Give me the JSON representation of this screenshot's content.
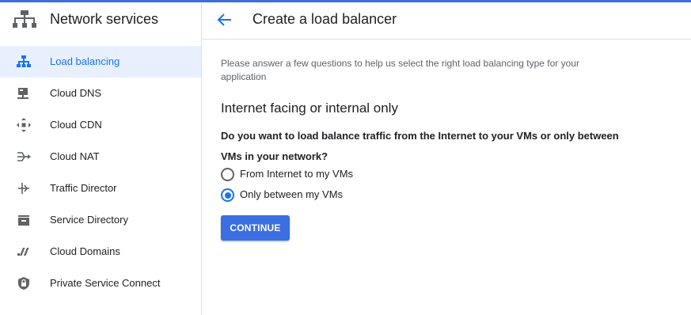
{
  "colors": {
    "accent": "#1a73e8",
    "button": "#3b6ee0",
    "active_bg": "#e8f0fe"
  },
  "sidebar": {
    "title": "Network services",
    "icon": "network-services-icon",
    "items": [
      {
        "label": "Load balancing",
        "icon": "load-balancing-icon",
        "active": true
      },
      {
        "label": "Cloud DNS",
        "icon": "cloud-dns-icon"
      },
      {
        "label": "Cloud CDN",
        "icon": "cloud-cdn-icon"
      },
      {
        "label": "Cloud NAT",
        "icon": "cloud-nat-icon"
      },
      {
        "label": "Traffic Director",
        "icon": "traffic-director-icon"
      },
      {
        "label": "Service Directory",
        "icon": "service-directory-icon"
      },
      {
        "label": "Cloud Domains",
        "icon": "cloud-domains-icon"
      },
      {
        "label": "Private Service Connect",
        "icon": "private-service-connect-icon"
      }
    ]
  },
  "main": {
    "back_icon": "arrow-back-icon",
    "title": "Create a load balancer",
    "intro": "Please answer a few questions to help us select the right load balancing type for your application",
    "section_title": "Internet facing or internal only",
    "question": "Do you want to load balance traffic from the Internet to your VMs or only between VMs in your network?",
    "options": [
      {
        "label": "From Internet to my VMs",
        "selected": false
      },
      {
        "label": "Only between my VMs",
        "selected": true
      }
    ],
    "continue_label": "CONTINUE"
  }
}
